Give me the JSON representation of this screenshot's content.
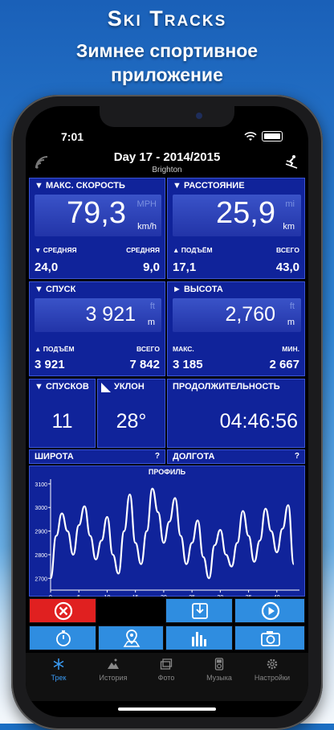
{
  "promo": {
    "title": "Ski Tracks",
    "subtitle_line1": "Зимнее спортивное",
    "subtitle_line2": "приложение"
  },
  "status_bar": {
    "time": "7:01"
  },
  "header": {
    "title": "Day 17 - 2014/2015",
    "subtitle": "Brighton"
  },
  "max_speed": {
    "label": "▼ МАКС. СКОРОСТЬ",
    "value": "79,3",
    "unit_dim": "MPH",
    "unit": "km/h",
    "sub_left_label": "▼ СРЕДНЯЯ",
    "sub_right_label": "СРЕДНЯЯ",
    "sub_left_value": "24,0",
    "sub_right_value": "9,0"
  },
  "distance": {
    "label": "▼ РАССТОЯНИЕ",
    "value": "25,9",
    "unit_dim": "mi",
    "unit": "km",
    "sub_left_label": "▲ ПОДЪЁМ",
    "sub_right_label": "ВСЕГО",
    "sub_left_value": "17,1",
    "sub_right_value": "43,0"
  },
  "descent": {
    "label": "▼ СПУСК",
    "value": "3 921",
    "unit_dim": "ft",
    "unit": "m",
    "sub_left_label": "▲ ПОДЪЁМ",
    "sub_right_label": "ВСЕГО",
    "sub_left_value": "3 921",
    "sub_right_value": "7 842"
  },
  "altitude": {
    "label": "► ВЫСОТА",
    "value": "2,760",
    "unit_dim": "ft",
    "unit": "m",
    "sub_left_label": "МАКС.",
    "sub_right_label": "МИН.",
    "sub_left_value": "3 185",
    "sub_right_value": "2 667"
  },
  "runs": {
    "label": "▼ СПУСКОВ",
    "value": "11"
  },
  "slope": {
    "label": "УКЛОН",
    "value": "28°"
  },
  "duration": {
    "label": "ПРОДОЛЖИТЕЛЬНОСТЬ",
    "value": "04:46:56"
  },
  "latitude": {
    "label": "ШИРОТА",
    "value": "?"
  },
  "longitude": {
    "label": "ДОЛГОТА",
    "value": "?"
  },
  "chart_data": {
    "type": "line",
    "title": "ПРОФИЛЬ",
    "x": [
      0,
      1,
      2,
      3,
      4,
      5,
      6,
      7,
      8,
      9,
      10,
      11,
      12,
      13,
      14,
      15,
      16,
      17,
      18,
      19,
      20,
      21,
      22,
      23,
      24,
      25,
      26,
      27,
      28,
      29,
      30,
      31,
      32,
      33,
      34,
      35,
      36,
      37,
      38,
      39,
      40,
      41,
      42,
      43
    ],
    "series": [
      {
        "values": [
          2700,
          2880,
          2975,
          2900,
          2800,
          2925,
          3005,
          2880,
          2780,
          2860,
          2960,
          2800,
          2720,
          2900,
          3055,
          2850,
          2760,
          2900,
          3080,
          2980,
          2850,
          2940,
          3040,
          2880,
          2760,
          2850,
          2945,
          2790,
          2700,
          2840,
          2905,
          2800,
          2750,
          2850,
          2985,
          2880,
          2770,
          2860,
          2995,
          2900,
          2810,
          2910,
          3010,
          2760
        ]
      }
    ],
    "xticks": [
      0,
      5,
      10,
      15,
      20,
      25,
      30,
      35,
      40
    ],
    "yticks": [
      2700,
      2800,
      2900,
      3000,
      3100
    ],
    "xlim": [
      0,
      44
    ],
    "ylim": [
      2650,
      3120
    ],
    "line_color": "#ffffff"
  },
  "toolbar": {
    "row1": [
      {
        "icon": "close-icon",
        "color": "#e02020"
      },
      {
        "icon": "empty",
        "color": "#000000"
      },
      {
        "icon": "download-icon",
        "color": "#2f8de0"
      },
      {
        "icon": "play-icon",
        "color": "#2f8de0"
      }
    ],
    "row2": [
      {
        "icon": "stopwatch-icon",
        "color": "#2f8de0"
      },
      {
        "icon": "map-pin-icon",
        "color": "#2f8de0"
      },
      {
        "icon": "bar-chart-icon",
        "color": "#2f8de0"
      },
      {
        "icon": "camera-icon",
        "color": "#2f8de0"
      }
    ]
  },
  "tabs": [
    {
      "label": "Трек",
      "icon": "snowflake-icon",
      "active": true
    },
    {
      "label": "История",
      "icon": "snow-mountain-icon",
      "active": false
    },
    {
      "label": "Фото",
      "icon": "photos-icon",
      "active": false
    },
    {
      "label": "Музыка",
      "icon": "ipod-icon",
      "active": false
    },
    {
      "label": "Настройки",
      "icon": "gear-icon",
      "active": false
    }
  ]
}
